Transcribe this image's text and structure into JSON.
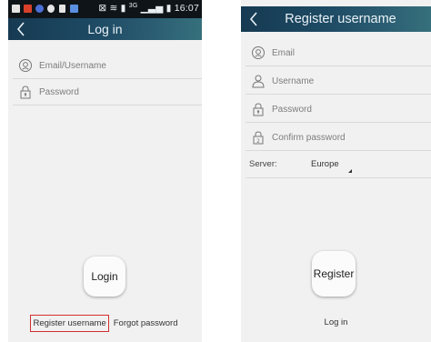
{
  "status_bar": {
    "time": "16:07",
    "network_label": "3G",
    "icon_colors": [
      "#e4e4e4",
      "#d8402a",
      "#4b6fd6",
      "#e5e5e5",
      "#e5e5e5",
      "#5a8ee0"
    ]
  },
  "login_screen": {
    "title": "Log in",
    "fields": {
      "email_placeholder": "Email/Username",
      "password_placeholder": "Password"
    },
    "login_button_label": "Login",
    "register_link_label": "Register username",
    "forgot_link_label": "Forgot password"
  },
  "register_screen": {
    "title": "Register username",
    "fields": {
      "email_placeholder": "Email",
      "username_placeholder": "Username",
      "password_placeholder": "Password",
      "confirm_password_placeholder": "Confirm password"
    },
    "server": {
      "label": "Server:",
      "selected": "Europe"
    },
    "register_button_label": "Register",
    "login_link_label": "Log in"
  },
  "colors": {
    "header_start": "#163a52",
    "header_end": "#36707c",
    "highlight_border": "#d32f2f",
    "status_bar": "#0f1419"
  },
  "icons": {
    "back": "chevron-left-icon",
    "email": "at-sign-icon",
    "username": "person-icon",
    "password": "lock-icon",
    "confirm_password": "lock-2-icon"
  }
}
